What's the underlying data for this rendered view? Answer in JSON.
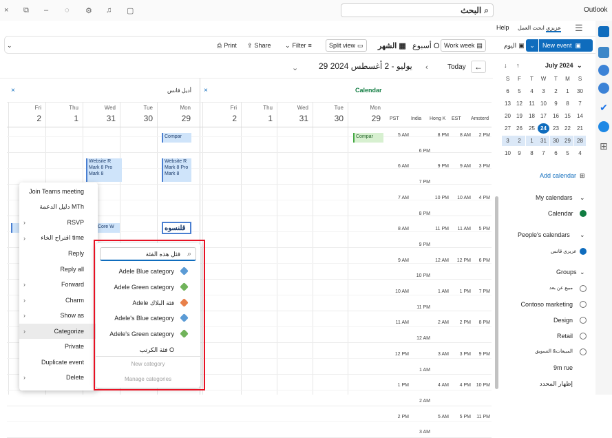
{
  "app": {
    "title": "Outlook",
    "window_controls": [
      "×",
      "⧉",
      "–"
    ]
  },
  "search": {
    "value": "البحث"
  },
  "menu": {
    "file": "عزيزي",
    "help": "Help",
    "view": "ابحث العمل"
  },
  "ribbon": {
    "new_event": "New event",
    "today_btn": "اليوم",
    "work_week": "Work week",
    "week": "أسبوع O",
    "month": "الشهر",
    "split_view": "Split view",
    "filter": "Filter",
    "share": "Share",
    "print": "Print"
  },
  "calendar_nav": {
    "today": "Today",
    "range": "29 يوليو - 2 أغسطس 2024",
    "mini_month": "July 2024"
  },
  "mini_cal": {
    "dow": [
      "S",
      "M",
      "T",
      "W",
      "T",
      "F",
      "S"
    ],
    "weeks": [
      [
        "30",
        "1",
        "2",
        "3",
        "4",
        "5",
        "6"
      ],
      [
        "7",
        "8",
        "9",
        "10",
        "11",
        "12",
        "13"
      ],
      [
        "14",
        "15",
        "16",
        "17",
        "18",
        "19",
        "20"
      ],
      [
        "21",
        "22",
        "23",
        "24",
        "25",
        "26",
        "27"
      ],
      [
        "28",
        "29",
        "30",
        "31",
        "1",
        "2",
        "3"
      ],
      [
        "4",
        "5",
        "6",
        "7",
        "8",
        "9",
        "10"
      ]
    ],
    "selected": "24"
  },
  "left_nav": {
    "add_calendar": "Add calendar",
    "my_calendars": "My calendars",
    "calendar": "Calendar",
    "peoples_calendars": "People's calendars",
    "person": "عزيزي قانس",
    "groups": "Groups",
    "group_items": [
      "مبيع عن بعد",
      "Contoso marketing",
      "Design",
      "Retail",
      "المبيعات& التسويق",
      "9m rue",
      "إظهار المحدد"
    ]
  },
  "panes": {
    "left_title": "Calendar",
    "right_title": "أديل قانس",
    "close": "×"
  },
  "days": [
    {
      "dow": "Mon",
      "num": "29"
    },
    {
      "dow": "Tue",
      "num": "30"
    },
    {
      "dow": "Wed",
      "num": "31"
    },
    {
      "dow": "Thu",
      "num": "1"
    },
    {
      "dow": "Fri",
      "num": "2"
    }
  ],
  "timezones": [
    "Amsterd",
    "EST",
    "Hong K",
    "India",
    "PST"
  ],
  "tz_rows": [
    [
      "2 PM",
      "8 AM",
      "8 PM",
      "",
      "5 AM"
    ],
    [
      "",
      "",
      "",
      "6 PM",
      ""
    ],
    [
      "3 PM",
      "9 AM",
      "9 PM",
      "",
      "6 AM"
    ],
    [
      "",
      "",
      "",
      "7 PM",
      ""
    ],
    [
      "4 PM",
      "10 AM",
      "10 PM",
      "",
      "7 AM"
    ],
    [
      "",
      "",
      "",
      "8 PM",
      ""
    ],
    [
      "5 PM",
      "11 AM",
      "11 PM",
      "",
      "8 AM"
    ],
    [
      "",
      "",
      "",
      "9 PM",
      ""
    ],
    [
      "6 PM",
      "12 PM",
      "12 AM",
      "",
      "9 AM"
    ],
    [
      "",
      "",
      "",
      "10 PM",
      ""
    ],
    [
      "7 PM",
      "1 PM",
      "1 AM",
      "",
      "10 AM"
    ],
    [
      "",
      "",
      "",
      "11 PM",
      ""
    ],
    [
      "8 PM",
      "2 PM",
      "2 AM",
      "",
      "11 AM"
    ],
    [
      "",
      "",
      "",
      "12 AM",
      ""
    ],
    [
      "9 PM",
      "3 PM",
      "3 AM",
      "",
      "12 PM"
    ],
    [
      "",
      "",
      "",
      "1 AM",
      ""
    ],
    [
      "10 PM",
      "4 PM",
      "4 AM",
      "",
      "1 PM"
    ],
    [
      "",
      "",
      "",
      "2 AM",
      ""
    ],
    [
      "11 PM",
      "5 PM",
      "5 AM",
      "",
      "2 PM"
    ],
    [
      "",
      "",
      "",
      "3 AM",
      ""
    ]
  ],
  "events": {
    "compar": "Compar",
    "website_r": "Website R",
    "mark8pro": "Mark 8 Pro",
    "mark8": "Mark 8",
    "ameen": "قلنسوه",
    "core": "Core W"
  },
  "context_menu": [
    {
      "label": "Join Teams meeting",
      "sub": false
    },
    {
      "label": "دليل الدعمة MTh",
      "sub": false
    },
    {
      "label": "RSVP",
      "sub": true
    },
    {
      "label": "اقتراح الخاء time",
      "sub": true
    },
    {
      "label": "Reply",
      "sub": false
    },
    {
      "label": "Reply all",
      "sub": false
    },
    {
      "label": "Forward",
      "sub": true
    },
    {
      "label": "Charm",
      "sub": true
    },
    {
      "label": "Show as",
      "sub": true
    },
    {
      "label": "Categorize",
      "sub": true
    },
    {
      "label": "Private",
      "sub": false
    },
    {
      "label": "Duplicate event",
      "sub": false
    },
    {
      "label": "Delete",
      "sub": true
    }
  ],
  "categorize": {
    "search_placeholder": "فئل هذه الفئة",
    "items": [
      {
        "label": "Adele Blue category",
        "color": "#5b9bd5"
      },
      {
        "label": "Adele Green category",
        "color": "#70b35a"
      },
      {
        "label": "Adele فئة البلاك",
        "color": "#e8804a"
      },
      {
        "label": "Adele's Blue category",
        "color": "#5b9bd5"
      },
      {
        "label": "Adele's Green category",
        "color": "#70b35a"
      },
      {
        "label": "فئة الكرتب O",
        "color": ""
      }
    ],
    "new_category": "New category",
    "manage": "Manage categories"
  }
}
